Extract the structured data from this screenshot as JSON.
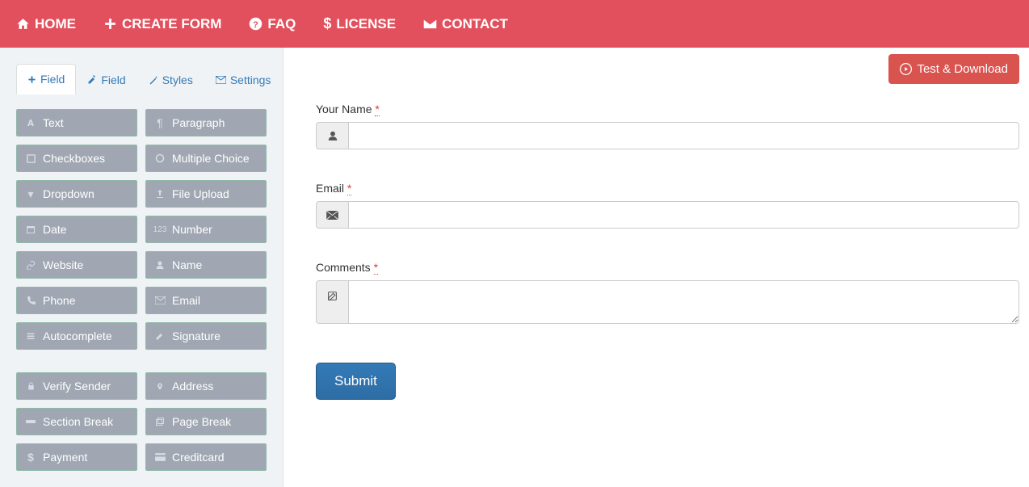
{
  "nav": {
    "home": "HOME",
    "create": "CREATE FORM",
    "faq": "FAQ",
    "license": "LICENSE",
    "contact": "CONTACT"
  },
  "tabs": {
    "add_field": "Field",
    "edit_field": "Field",
    "styles": "Styles",
    "settings": "Settings"
  },
  "fields": {
    "text": "Text",
    "paragraph": "Paragraph",
    "checkboxes": "Checkboxes",
    "multiple_choice": "Multiple Choice",
    "dropdown": "Dropdown",
    "file_upload": "File Upload",
    "date": "Date",
    "number": "Number",
    "website": "Website",
    "name": "Name",
    "phone": "Phone",
    "email": "Email",
    "autocomplete": "Autocomplete",
    "signature": "Signature",
    "verify_sender": "Verify Sender",
    "address": "Address",
    "section_break": "Section Break",
    "page_break": "Page Break",
    "payment": "Payment",
    "creditcard": "Creditcard"
  },
  "buttons": {
    "test_download": "Test & Download",
    "submit": "Submit"
  },
  "form": {
    "name_label": "Your Name ",
    "email_label": "Email ",
    "comments_label": "Comments ",
    "req": "*",
    "name_value": "",
    "email_value": "",
    "comments_value": ""
  }
}
